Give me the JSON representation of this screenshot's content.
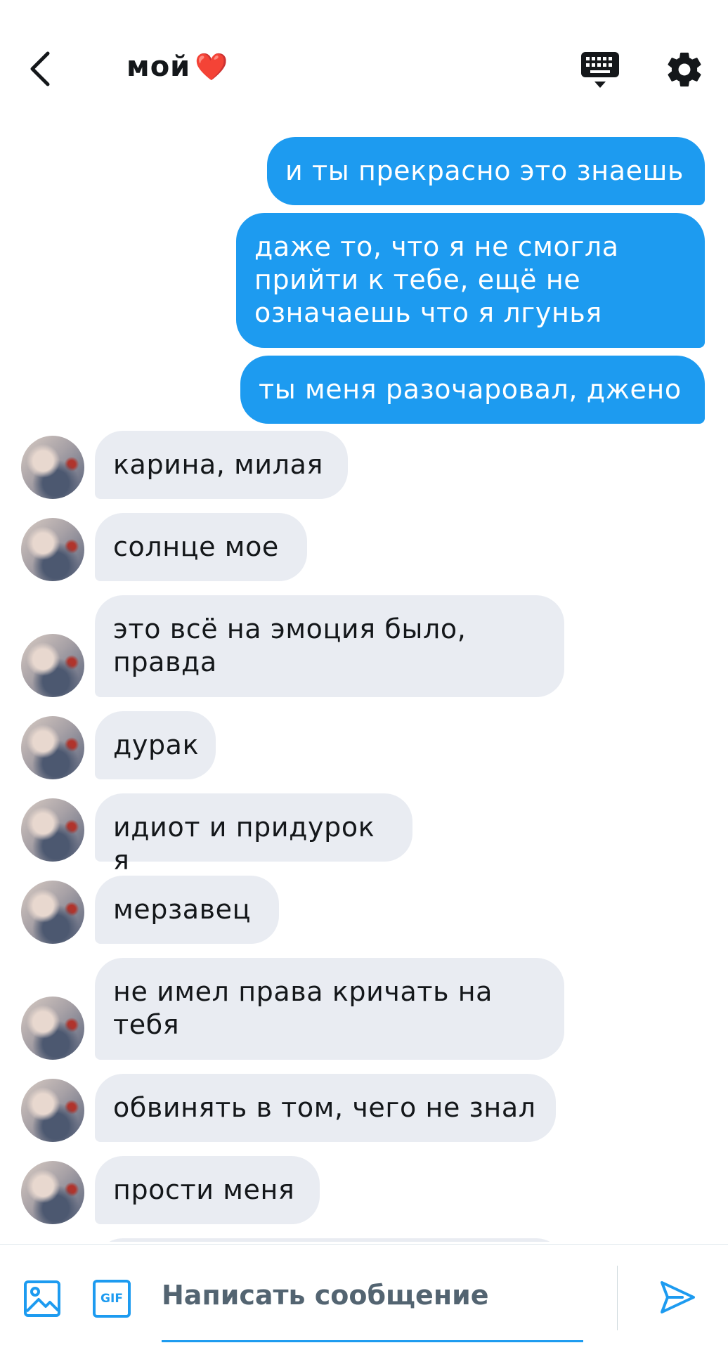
{
  "header": {
    "title": "мой",
    "title_emoji": "❤️"
  },
  "messages": {
    "outgoing": [
      "и ты прекрасно это знаешь",
      "даже то, что я не смогла прийти к тебе, ещё не означаешь что я лгунья",
      "ты меня разочаровал, джено"
    ],
    "incoming": [
      "карина, милая",
      "солнце мое",
      "это всё на эмоция было, правда",
      "дурак",
      "идиот и придурок я",
      "мерзавец",
      "не имел права кричать на тебя",
      "обвинять в том, чего не знал",
      "прости меня"
    ]
  },
  "composer": {
    "placeholder": "Написать сообщение",
    "gif_label": "GIF"
  },
  "colors": {
    "accent": "#1d9bf0",
    "incoming_bubble": "#e9ecf2",
    "heart": "#f0454e"
  },
  "icons": [
    "back-arrow-icon",
    "keyboard-icon",
    "gear-icon",
    "image-icon",
    "gif-icon",
    "send-icon"
  ]
}
